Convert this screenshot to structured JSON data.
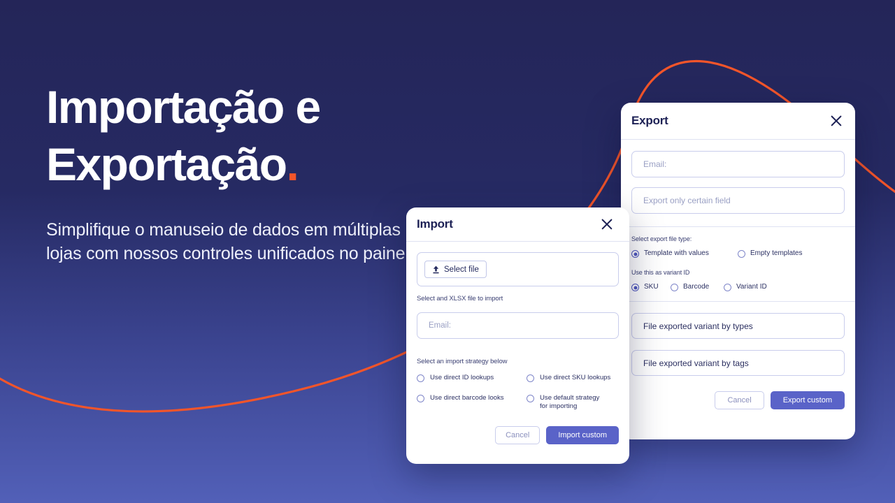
{
  "theme": {
    "bg_top": "#242558",
    "bg_bottom": "#5260b8",
    "accent_orange": "#f3552a",
    "primary_blue": "#5a63c8",
    "text_dark": "#1d2155"
  },
  "hero": {
    "title_line1": "Importação e",
    "title_line2": "Exportação",
    "title_dot": ".",
    "subtitle": "Simplifique o manuseio de dados em múltiplas lojas com nossos controles unificados no painel."
  },
  "import_dialog": {
    "title": "Import",
    "close_icon": "close-icon",
    "select_file_label": "Select file",
    "upload_icon": "upload-icon",
    "helper_text": "Select and XLSX file to import",
    "email_placeholder": "Email:",
    "strategy_label": "Select an import strategy below",
    "strategies": [
      {
        "label": "Use direct ID lookups",
        "selected": false
      },
      {
        "label": "Use direct SKU lookups",
        "selected": false
      },
      {
        "label": "Use direct barcode looks",
        "selected": false
      },
      {
        "label": "Use default strategy for importing",
        "selected": false
      }
    ],
    "cancel_label": "Cancel",
    "submit_label": "Import custom"
  },
  "export_dialog": {
    "title": "Export",
    "close_icon": "close-icon",
    "email_placeholder": "Email:",
    "field_certain_label": "Export only certain field",
    "file_type_label": "Select export file type:",
    "file_types": [
      {
        "label": "Template with values",
        "selected": true
      },
      {
        "label": "Empty templates",
        "selected": false
      }
    ],
    "variant_id_label": "Use this as variant ID",
    "variant_ids": [
      {
        "label": "SKU",
        "selected": true
      },
      {
        "label": "Barcode",
        "selected": false
      },
      {
        "label": "Variant ID",
        "selected": false
      }
    ],
    "field_by_types_label": "File exported variant by types",
    "field_by_tags_label": "File exported variant by tags",
    "cancel_label": "Cancel",
    "submit_label": "Export custom"
  }
}
